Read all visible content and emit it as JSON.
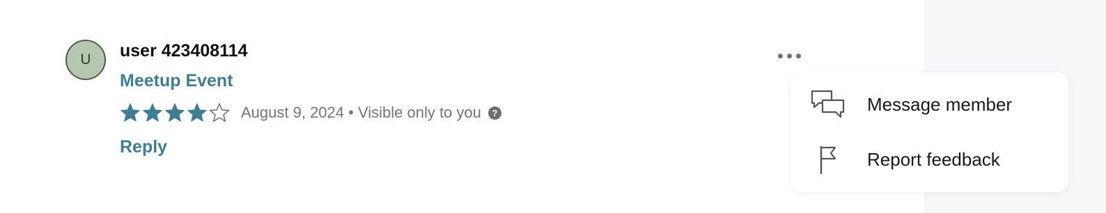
{
  "review": {
    "avatar_initial": "U",
    "user_name": "user 423408114",
    "event_name": "Meetup Event",
    "rating": 4,
    "rating_max": 5,
    "date": "August 9, 2024",
    "separator": " • ",
    "visibility": "Visible only to you",
    "help_glyph": "?",
    "reply_label": "Reply"
  },
  "menu": {
    "more_icon": "more-horizontal-icon",
    "items": [
      {
        "label": "Message member",
        "icon": "message-bubbles-icon"
      },
      {
        "label": "Report feedback",
        "icon": "flag-icon"
      }
    ]
  },
  "colors": {
    "accent": "#3e7e91",
    "star_filled": "#3e7e91",
    "star_empty_outline": "#757575",
    "avatar_bg": "#b6c7b0",
    "side_panel_bg": "#f6f7f8"
  }
}
